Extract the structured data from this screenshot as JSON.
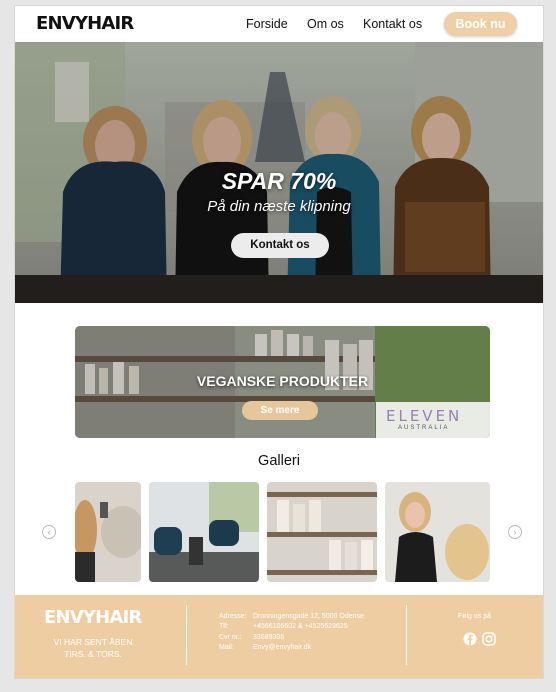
{
  "header": {
    "logo": "ENVYHAIR",
    "nav": [
      "Forside",
      "Om os",
      "Kontakt os"
    ],
    "book_label": "Book nu"
  },
  "hero": {
    "title": "SPAR 70%",
    "subtitle": "På din næste klipning",
    "button_label": "Kontakt os"
  },
  "products": {
    "title": "VEGANSKE PRODUKTER",
    "button_label": "Se mere",
    "brand_logo": "ELEVEN",
    "brand_sub": "AUSTRALIA"
  },
  "gallery": {
    "title": "Galleri",
    "prev_icon": "chevron-left-icon",
    "next_icon": "chevron-right-icon"
  },
  "footer": {
    "logo": "ENVYHAIR",
    "hours_line1": "VI HAR SENT ÅBEN",
    "hours_line2": "TIRS. & TORS.",
    "address_label": "Adresse:",
    "address_value": "Dronningensgade 12, 5000 Odense",
    "phone_label": "Tlf:",
    "phone_value": "+4566106602 & +4525623625",
    "cvr_label": "Cvr nr.:",
    "cvr_value": "33689306",
    "mail_label": "Mail:",
    "mail_value": "Envy@envyhair.dk",
    "follow_label": "Følg os på",
    "social_icons": [
      "facebook-icon",
      "instagram-icon"
    ]
  },
  "colors": {
    "accent": "#eecfa6",
    "footer_bg": "#efcda2",
    "page_bg": "#e6e6e6"
  }
}
